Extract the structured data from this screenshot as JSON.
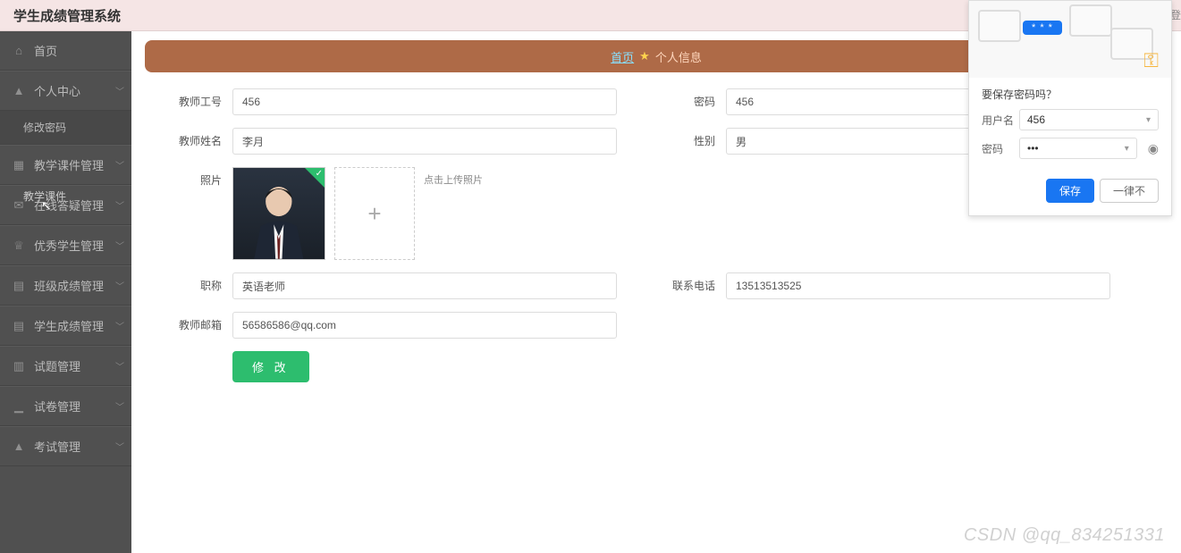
{
  "header": {
    "title": "学生成绩管理系统",
    "peek_text": "登"
  },
  "sidebar": {
    "items": [
      {
        "label": "首页",
        "icon": "home"
      },
      {
        "label": "个人中心",
        "icon": "user",
        "expand": true
      },
      {
        "label": "教学课件管理",
        "icon": "grid",
        "expand": true
      },
      {
        "label": "在线答疑管理",
        "icon": "chat",
        "expand": true
      },
      {
        "label": "优秀学生管理",
        "icon": "trophy",
        "expand": true
      },
      {
        "label": "班级成绩管理",
        "icon": "flag",
        "expand": true
      },
      {
        "label": "学生成绩管理",
        "icon": "list",
        "expand": true
      },
      {
        "label": "试题管理",
        "icon": "file",
        "expand": true
      },
      {
        "label": "试卷管理",
        "icon": "bars",
        "expand": true
      },
      {
        "label": "考试管理",
        "icon": "user",
        "expand": true
      }
    ],
    "sub_change_pwd": "修改密码",
    "ghost_courseware": "教学课件"
  },
  "breadcrumb": {
    "home": "首页",
    "star": "★",
    "current": "个人信息"
  },
  "form": {
    "teacher_id": {
      "label": "教师工号",
      "value": "456"
    },
    "password": {
      "label": "密码",
      "value": "456"
    },
    "teacher_name": {
      "label": "教师姓名",
      "value": "李月"
    },
    "gender": {
      "label": "性别",
      "value": "男"
    },
    "photo": {
      "label": "照片",
      "hint": "点击上传照片"
    },
    "title": {
      "label": "职称",
      "value": "英语老师"
    },
    "phone": {
      "label": "联系电话",
      "value": "13513513525"
    },
    "email": {
      "label": "教师邮箱",
      "value": "56586586@qq.com"
    },
    "submit": "修 改"
  },
  "popup": {
    "chip": "* * *",
    "prompt": "要保存密码吗？",
    "user_label": "用户名",
    "user_value": "456",
    "pwd_label": "密码",
    "pwd_value": "•••",
    "save": "保存",
    "never": "一律不"
  },
  "watermark": "CSDN @qq_834251331"
}
